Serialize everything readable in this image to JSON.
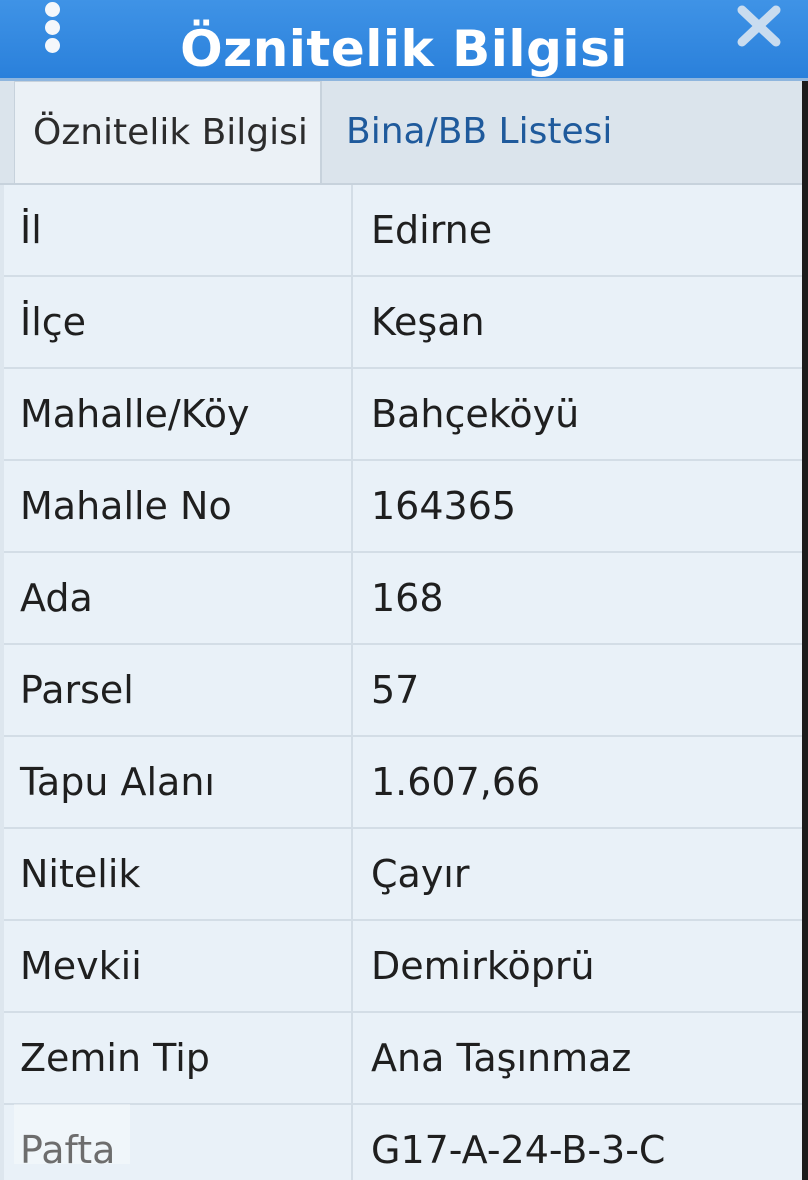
{
  "window": {
    "title": "Öznitelik Bilgisi"
  },
  "icons": {
    "menu": "more-vertical-icon",
    "close": "close-icon"
  },
  "tabs": [
    {
      "label": "Öznitelik Bilgisi",
      "active": true
    },
    {
      "label": "Bina/BB Listesi",
      "active": false
    }
  ],
  "rows": [
    {
      "label": "İl",
      "value": "Edirne"
    },
    {
      "label": "İlçe",
      "value": "Keşan"
    },
    {
      "label": "Mahalle/Köy",
      "value": "Bahçeköyü"
    },
    {
      "label": "Mahalle No",
      "value": "164365"
    },
    {
      "label": "Ada",
      "value": "168"
    },
    {
      "label": "Parsel",
      "value": "57"
    },
    {
      "label": "Tapu Alanı",
      "value": "1.607,66"
    },
    {
      "label": "Nitelik",
      "value": "Çayır"
    },
    {
      "label": "Mevkii",
      "value": "Demirköprü"
    },
    {
      "label": "Zemin Tip",
      "value": "Ana Taşınmaz"
    },
    {
      "label": "Pafta",
      "value": "G17-A-24-B-3-C"
    }
  ],
  "colors": {
    "titlebar": "#2a80db",
    "inactive_tab_text": "#1f5a9c"
  }
}
